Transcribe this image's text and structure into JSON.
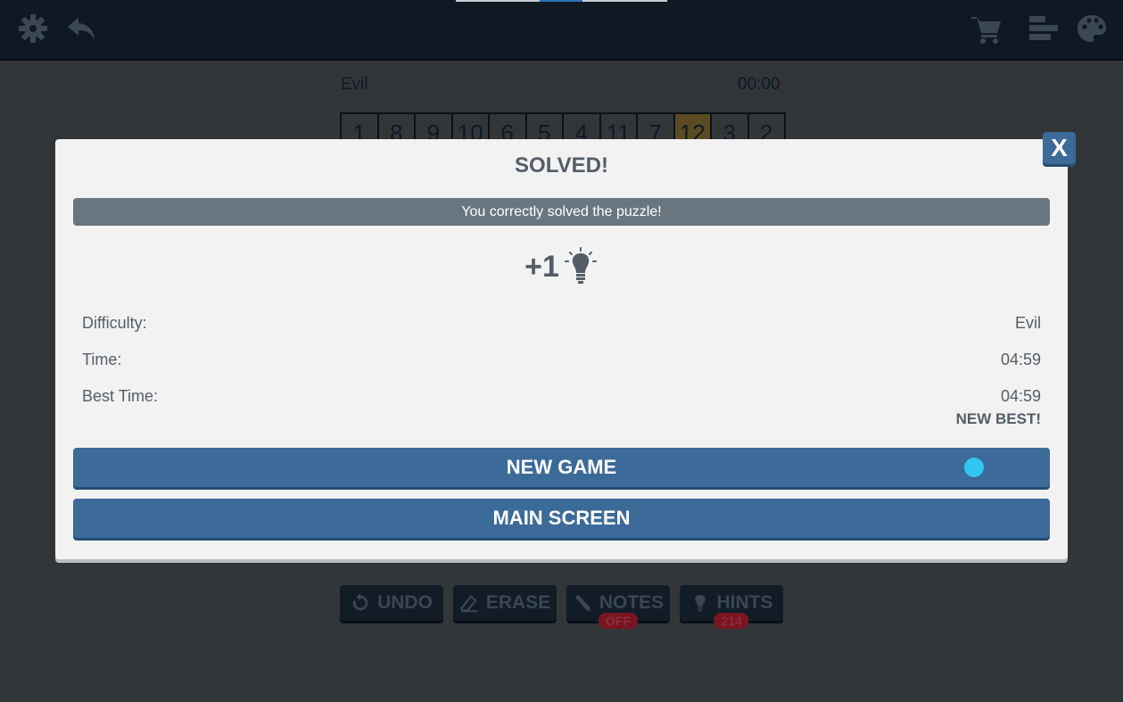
{
  "topbar": {
    "icons_left": [
      "gear-icon",
      "back-arrow-icon"
    ],
    "icons_right": [
      "cart-icon",
      "stats-bars-icon",
      "palette-icon"
    ]
  },
  "game": {
    "difficulty": "Evil",
    "timer": "00:00",
    "numbers": [
      "1",
      "8",
      "9",
      "10",
      "6",
      "5",
      "4",
      "11",
      "7",
      "12",
      "3",
      "2"
    ],
    "highlighted_number": "12",
    "tools": [
      {
        "label": "UNDO",
        "icon": "undo-icon"
      },
      {
        "label": "ERASE",
        "icon": "eraser-icon"
      },
      {
        "label": "NOTES",
        "icon": "pencil-icon",
        "badge": "OFF"
      },
      {
        "label": "HINTS",
        "icon": "lightbulb-icon",
        "badge": "214"
      }
    ]
  },
  "dialog": {
    "close_label": "X",
    "title": "SOLVED!",
    "message": "You correctly solved the puzzle!",
    "reward": "+1",
    "reward_icon": "lightbulb-icon",
    "stats": [
      {
        "label": "Difficulty:",
        "value": "Evil"
      },
      {
        "label": "Time:",
        "value": "04:59"
      },
      {
        "label": "Best Time:",
        "value": "04:59"
      }
    ],
    "new_best": "NEW BEST!",
    "new_game": "NEW GAME",
    "main_screen": "MAIN SCREEN"
  },
  "colors": {
    "accent": "#3c6a99",
    "topbar": "#0f1923",
    "dialog_bg": "#f2f2f2",
    "banner": "#6a767f",
    "touch": "#33c6f0"
  }
}
